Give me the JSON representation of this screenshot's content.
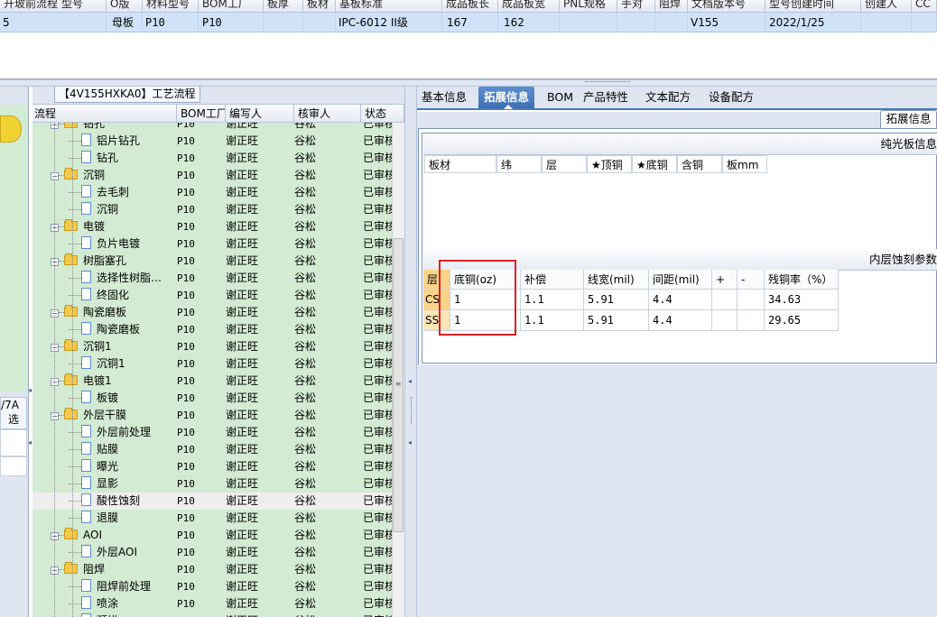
{
  "top_grid": {
    "headers": [
      "开玻前流程 型号",
      "O版",
      "材料型号",
      "BOM工厂",
      "板厚",
      "板材",
      "基板标准",
      "成品板长",
      "成品板宽",
      "PNL规格",
      "手对",
      "阻焊",
      "文档版本号",
      "型号创建时间",
      "创建人",
      "CC"
    ],
    "row": [
      "5",
      "母板",
      "P10",
      "P10",
      "",
      "",
      "IPC-6012 II级",
      "167",
      "162",
      "",
      "",
      "",
      "V155",
      "2022/1/25",
      "",
      ""
    ]
  },
  "left_panel": {
    "labels": [
      "/7A",
      "选"
    ]
  },
  "process_panel": {
    "title": "【4V155HXKA0】工艺流程",
    "columns": [
      "流程",
      "BOM工厂",
      "编写人",
      "核审人",
      "状态"
    ],
    "rows": [
      {
        "name": "钻孔",
        "type": "folder",
        "factory": "P10",
        "writer": "谢正旺",
        "reviewer": "谷松",
        "status": "已审核"
      },
      {
        "name": "铝片钻孔",
        "type": "doc",
        "factory": "P10",
        "writer": "谢正旺",
        "reviewer": "谷松",
        "status": "已审核"
      },
      {
        "name": "钻孔",
        "type": "doc",
        "factory": "P10",
        "writer": "谢正旺",
        "reviewer": "谷松",
        "status": "已审核"
      },
      {
        "name": "沉铜",
        "type": "folder",
        "factory": "P10",
        "writer": "谢正旺",
        "reviewer": "谷松",
        "status": "已审核"
      },
      {
        "name": "去毛刺",
        "type": "doc",
        "factory": "P10",
        "writer": "谢正旺",
        "reviewer": "谷松",
        "status": "已审核"
      },
      {
        "name": "沉铜",
        "type": "doc",
        "factory": "P10",
        "writer": "谢正旺",
        "reviewer": "谷松",
        "status": "已审核"
      },
      {
        "name": "电镀",
        "type": "folder",
        "factory": "P10",
        "writer": "谢正旺",
        "reviewer": "谷松",
        "status": "已审核"
      },
      {
        "name": "负片电镀",
        "type": "doc",
        "factory": "P10",
        "writer": "谢正旺",
        "reviewer": "谷松",
        "status": "已审核"
      },
      {
        "name": "树脂塞孔",
        "type": "folder",
        "factory": "P10",
        "writer": "谢正旺",
        "reviewer": "谷松",
        "status": "已审核"
      },
      {
        "name": "选择性树脂…",
        "type": "doc",
        "factory": "P10",
        "writer": "谢正旺",
        "reviewer": "谷松",
        "status": "已审核"
      },
      {
        "name": "终固化",
        "type": "doc",
        "factory": "P10",
        "writer": "谢正旺",
        "reviewer": "谷松",
        "status": "已审核"
      },
      {
        "name": "陶瓷磨板",
        "type": "folder",
        "factory": "P10",
        "writer": "谢正旺",
        "reviewer": "谷松",
        "status": "已审核"
      },
      {
        "name": "陶瓷磨板",
        "type": "doc",
        "factory": "P10",
        "writer": "谢正旺",
        "reviewer": "谷松",
        "status": "已审核"
      },
      {
        "name": "沉铜1",
        "type": "folder",
        "factory": "P10",
        "writer": "谢正旺",
        "reviewer": "谷松",
        "status": "已审核"
      },
      {
        "name": "沉铜1",
        "type": "doc",
        "factory": "P10",
        "writer": "谢正旺",
        "reviewer": "谷松",
        "status": "已审核"
      },
      {
        "name": "电镀1",
        "type": "folder",
        "factory": "P10",
        "writer": "谢正旺",
        "reviewer": "谷松",
        "status": "已审核"
      },
      {
        "name": "板镀",
        "type": "doc",
        "factory": "P10",
        "writer": "谢正旺",
        "reviewer": "谷松",
        "status": "已审核"
      },
      {
        "name": "外层干膜",
        "type": "folder",
        "factory": "P10",
        "writer": "谢正旺",
        "reviewer": "谷松",
        "status": "已审核"
      },
      {
        "name": "外层前处理",
        "type": "doc",
        "factory": "P10",
        "writer": "谢正旺",
        "reviewer": "谷松",
        "status": "已审核"
      },
      {
        "name": "贴膜",
        "type": "doc",
        "factory": "P10",
        "writer": "谢正旺",
        "reviewer": "谷松",
        "status": "已审核"
      },
      {
        "name": "曝光",
        "type": "doc",
        "factory": "P10",
        "writer": "谢正旺",
        "reviewer": "谷松",
        "status": "已审核"
      },
      {
        "name": "显影",
        "type": "doc",
        "factory": "P10",
        "writer": "谢正旺",
        "reviewer": "谷松",
        "status": "已审核"
      },
      {
        "name": "酸性蚀刻",
        "type": "doc",
        "factory": "P10",
        "writer": "谢正旺",
        "reviewer": "谷松",
        "status": "已审核",
        "selected": true
      },
      {
        "name": "退膜",
        "type": "doc",
        "factory": "P10",
        "writer": "谢正旺",
        "reviewer": "谷松",
        "status": "已审核"
      },
      {
        "name": "AOI",
        "type": "folder",
        "factory": "P10",
        "writer": "谢正旺",
        "reviewer": "谷松",
        "status": "已审核"
      },
      {
        "name": "外层AOI",
        "type": "doc",
        "factory": "P10",
        "writer": "谢正旺",
        "reviewer": "谷松",
        "status": "已审核"
      },
      {
        "name": "阻焊",
        "type": "folder",
        "factory": "P10",
        "writer": "谢正旺",
        "reviewer": "谷松",
        "status": "已审核"
      },
      {
        "name": "阻焊前处理",
        "type": "doc",
        "factory": "P10",
        "writer": "谢正旺",
        "reviewer": "谷松",
        "status": "已审核"
      },
      {
        "name": "喷涂",
        "type": "doc",
        "factory": "P10",
        "writer": "谢正旺",
        "reviewer": "谷松",
        "status": "已审核"
      },
      {
        "name": "预烘",
        "type": "doc",
        "factory": "P10",
        "writer": "谢正旺",
        "reviewer": "谷松",
        "status": "已审核"
      }
    ]
  },
  "tabs": [
    "基本信息",
    "拓展信息",
    "BOM",
    "产品特性",
    "文本配方",
    "设备配方"
  ],
  "active_tab": "拓展信息",
  "sub_tab": "拓展信息",
  "group_pure": {
    "title": "纯光板信息",
    "columns": [
      "板材",
      "纬",
      "层",
      "★顶铜",
      "★底铜",
      "含铜",
      "板mm"
    ]
  },
  "group_etch": {
    "title": "内层蚀刻参数",
    "columns": [
      "层",
      "底铜(oz)",
      "补偿",
      "线宽(mil)",
      "间距(mil)",
      "+",
      "-",
      "残铜率（%）"
    ],
    "rows": [
      [
        "CS",
        "1",
        "1.1",
        "5.91",
        "4.4",
        "",
        "",
        "34.63"
      ],
      [
        "SS",
        "1",
        "1.1",
        "5.91",
        "4.4",
        "",
        "",
        "29.65"
      ]
    ]
  },
  "colors": {
    "accent": "#3d6fb4",
    "tree_bg": "#d3ebd2",
    "highlight": "#e02020"
  }
}
